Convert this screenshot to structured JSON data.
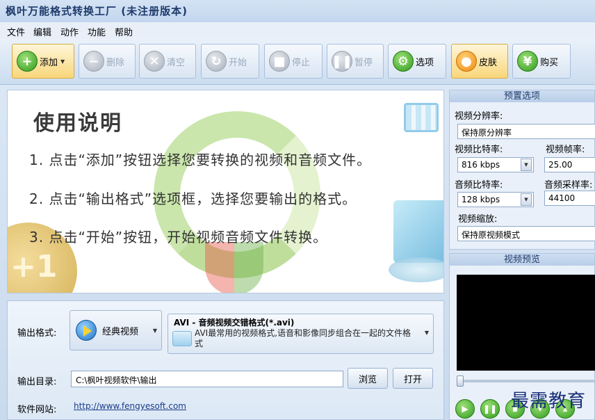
{
  "window": {
    "title": "枫叶万能格式转换工厂 (未注册版本)"
  },
  "menu": [
    "文件",
    "编辑",
    "动作",
    "功能",
    "帮助"
  ],
  "toolbar": {
    "add": "添加",
    "delete": "删除",
    "clear": "清空",
    "start": "开始",
    "stop": "停止",
    "pause": "暂停",
    "options": "选项",
    "skin": "皮肤",
    "buy": "购买"
  },
  "guide": {
    "title": "使用说明",
    "steps": [
      "1. 点击“添加”按钮选择您要转换的视频和音频文件。",
      "2. 点击“输出格式”选项框，选择您要输出的格式。",
      "3. 点击“开始”按钮，开始视频音频文件转换。"
    ],
    "badge": "+1"
  },
  "output": {
    "format_label": "输出格式:",
    "category_button": "经典视频",
    "format_title": "AVI - 音频视频交错格式(*.avi)",
    "format_desc": "AVI最常用的视频格式,语音和影像同步组合在一起的文件格式",
    "dir_label": "输出目录:",
    "dir_value": "C:\\枫叶视频软件\\输出",
    "browse": "浏览",
    "open": "打开",
    "site_label": "软件网站:",
    "site_url": "http://www.fengyesoft.com"
  },
  "preset": {
    "header": "预置选项",
    "resolution_label": "视频分辨率:",
    "resolution_value": "保持原分辨率",
    "vbitrate_label": "视频比特率:",
    "vbitrate_value": "816 kbps",
    "fps_label": "视频帧率:",
    "fps_value": "25.00",
    "abitrate_label": "音频比特率:",
    "abitrate_value": "128 kbps",
    "samplerate_label": "音频采样率:",
    "samplerate_value": "44100",
    "scale_label": "视频缩放:",
    "scale_value": "保持原视频模式"
  },
  "preview": {
    "header": "视频预览"
  },
  "watermark": "最需教育"
}
